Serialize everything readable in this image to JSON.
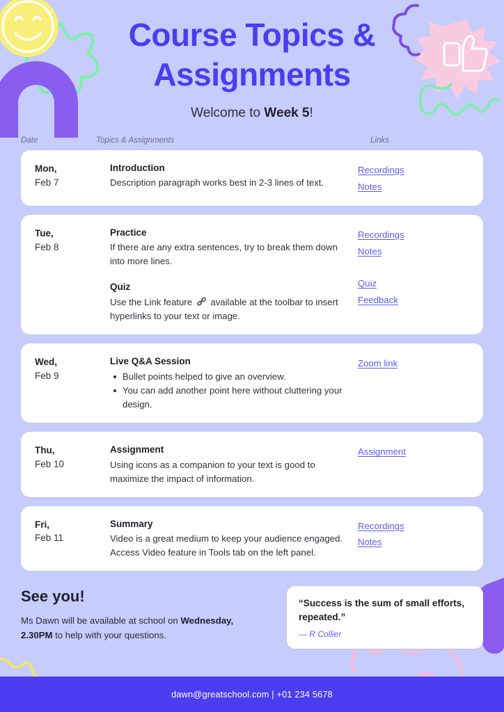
{
  "theme": {
    "background": "#c6ccfb",
    "accent": "#4a3df0",
    "link": "#5b5bec",
    "card": "#ffffff",
    "footer_bg": "#4a3df0",
    "yellow": "#f5eb6b",
    "green": "#7cf0a8",
    "purple": "#8b5cf0",
    "pink": "#f9cbe0"
  },
  "header": {
    "title": "Course Topics & Assignments",
    "subtitle_prefix": "Welcome to ",
    "subtitle_bold": "Week 5",
    "subtitle_suffix": "!"
  },
  "table": {
    "columns": {
      "date": "Date",
      "topics": "Topics & Assignments",
      "links": "Links"
    },
    "rows": [
      {
        "day": "Mon,",
        "date": "Feb 7",
        "blocks": [
          {
            "title": "Introduction",
            "desc": "Description paragraph works best in 2-3 lines of text."
          }
        ],
        "link_groups": [
          {
            "links": [
              "Recordings",
              "Notes"
            ]
          }
        ]
      },
      {
        "day": "Tue,",
        "date": "Feb 8",
        "blocks": [
          {
            "title": "Practice",
            "desc": "If there are any extra sentences, try to break them down into more lines."
          },
          {
            "title": "Quiz",
            "desc_before_icon": "Use the Link feature ",
            "icon": "chain-link-icon",
            "desc_after_icon": " available at the toolbar to insert hyperlinks to your text or image."
          }
        ],
        "link_groups": [
          {
            "links": [
              "Recordings",
              "Notes"
            ]
          },
          {
            "links": [
              "Quiz",
              "Feedback"
            ]
          }
        ]
      },
      {
        "day": "Wed,",
        "date": "Feb 9",
        "blocks": [
          {
            "title": "Live Q&A Session",
            "bullets": [
              "Bullet points helped to give an overview.",
              "You can add another point here without cluttering your design."
            ]
          }
        ],
        "link_groups": [
          {
            "links": [
              "Zoom link"
            ]
          }
        ]
      },
      {
        "day": "Thu,",
        "date": "Feb 10",
        "blocks": [
          {
            "title": "Assignment",
            "desc": "Using icons as a companion to your text is good to maximize the impact of information."
          }
        ],
        "link_groups": [
          {
            "links": [
              "Assignment"
            ]
          }
        ]
      },
      {
        "day": "Fri,",
        "date": "Feb 11",
        "blocks": [
          {
            "title": "Summary",
            "desc": "Video is a great medium to keep your audience engaged. Access Video feature in Tools tab on the left panel."
          }
        ],
        "link_groups": [
          {
            "links": [
              "Recordings",
              "Notes"
            ]
          }
        ]
      }
    ]
  },
  "closing": {
    "title": "See you!",
    "text_part1": "Ms Dawn will be available at school on ",
    "text_bold1": "Wednesday, 2.30PM",
    "text_part2": " to help with your questions."
  },
  "quote": {
    "text": "“Success is the sum of small efforts, repeated.”",
    "author": "— R Collier"
  },
  "footer": {
    "contact": "dawn@greatschool.com  |  +01 234 5678"
  },
  "decorations": [
    "smiley-face-icon",
    "flower-outline-icon",
    "purple-arch-icon",
    "cloud-outline-icon",
    "starburst-thumbs-up-icon",
    "green-squiggle-icon",
    "purple-blob-icon",
    "pink-squiggle-icon",
    "yellow-squiggle-icon"
  ]
}
